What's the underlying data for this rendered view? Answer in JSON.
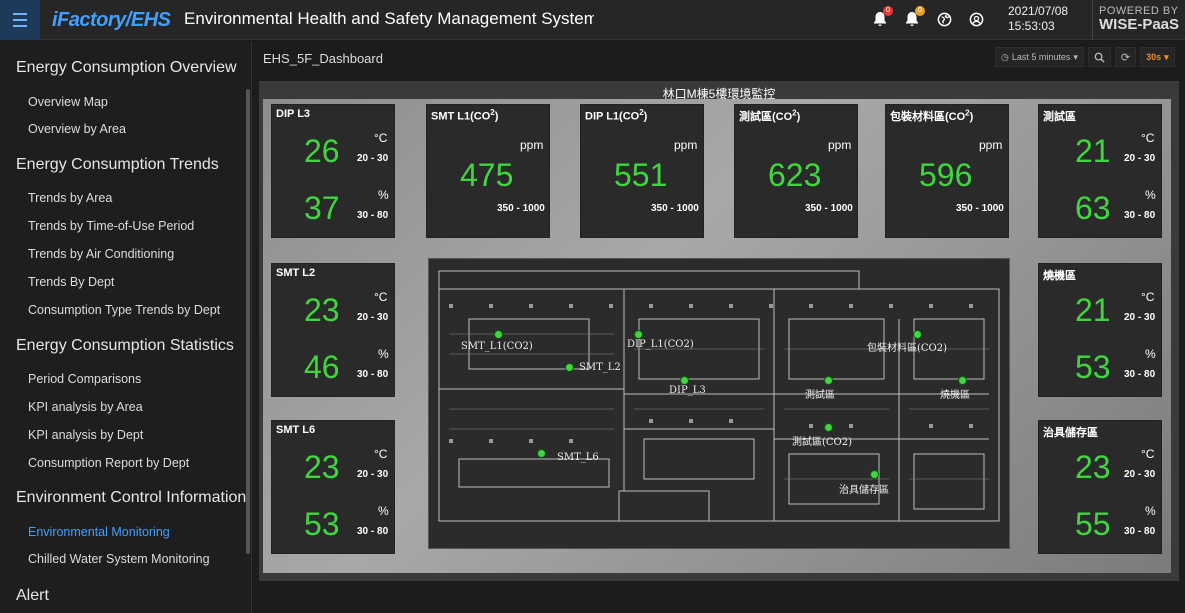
{
  "topbar": {
    "logo": "iFactory/EHS",
    "title": "Environmental Health and Safety Management System",
    "icons": [
      "bell-icon",
      "bell-icon",
      "globe-icon",
      "user-icon"
    ],
    "badge1": "0",
    "badge2": "0",
    "date": "2021/07/08",
    "time": "15:53:03",
    "powered_line1": "POWERED BY",
    "powered_line2": "WISE-PaaS",
    "accent": "#3fa0ff"
  },
  "sidebar": {
    "sections": [
      {
        "title": "Energy Consumption Overview",
        "items": [
          "Overview Map",
          "Overview by Area"
        ]
      },
      {
        "title": "Energy Consumption Trends",
        "items": [
          "Trends by Area",
          "Trends by Time-of-Use Period",
          "Trends by Air Conditioning",
          "Trends By Dept",
          "Consumption Type Trends by Dept"
        ]
      },
      {
        "title": "Energy Consumption Statistics",
        "items": [
          "Period Comparisons",
          "KPI analysis by Area",
          "KPI analysis by Dept",
          "Consumption Report by Dept"
        ]
      },
      {
        "title": "Environment Control Information",
        "items": [
          "Environmental Monitoring",
          "Chilled Water System Monitoring"
        ]
      },
      {
        "title": "Alert",
        "items": []
      }
    ],
    "active_item": "Environmental Monitoring"
  },
  "dashboard": {
    "title": "EHS_5F_Dashboard",
    "time_range": "Last 5 minutes",
    "refresh": "30s",
    "panel_title": "林口M棟5樓環境監控"
  },
  "tiles": {
    "dip_l3": {
      "name": "DIP L3",
      "temp": "26",
      "temp_unit": "°C",
      "temp_range": "20 - 30",
      "hum": "37",
      "hum_unit": "%",
      "hum_range": "30 - 80"
    },
    "smt_l2": {
      "name": "SMT L2",
      "temp": "23",
      "temp_unit": "°C",
      "temp_range": "20 - 30",
      "hum": "46",
      "hum_unit": "%",
      "hum_range": "30 - 80"
    },
    "smt_l6": {
      "name": "SMT L6",
      "temp": "23",
      "temp_unit": "°C",
      "temp_range": "20 - 30",
      "hum": "53",
      "hum_unit": "%",
      "hum_range": "30 - 80"
    },
    "test_area": {
      "name": "測試區",
      "temp": "21",
      "temp_unit": "°C",
      "temp_range": "20 - 30",
      "hum": "63",
      "hum_unit": "%",
      "hum_range": "30 - 80"
    },
    "burn_area": {
      "name": "燒機區",
      "temp": "21",
      "temp_unit": "°C",
      "temp_range": "20 - 30",
      "hum": "53",
      "hum_unit": "%",
      "hum_range": "30 - 80"
    },
    "fixture_store": {
      "name": "治具儲存區",
      "temp": "23",
      "temp_unit": "°C",
      "temp_range": "20 - 30",
      "hum": "55",
      "hum_unit": "%",
      "hum_range": "30 - 80"
    },
    "co2_smt_l1": {
      "name": "SMT L1(CO",
      "sub": "2",
      "tail": ")",
      "value": "475",
      "unit": "ppm",
      "range": "350 - 1000"
    },
    "co2_dip_l1": {
      "name": "DIP L1(CO",
      "sub": "2",
      "tail": ")",
      "value": "551",
      "unit": "ppm",
      "range": "350 - 1000"
    },
    "co2_test": {
      "name": "測試區(CO",
      "sub": "2",
      "tail": ")",
      "value": "623",
      "unit": "ppm",
      "range": "350 - 1000"
    },
    "co2_pack": {
      "name": "包裝材料區(CO",
      "sub": "2",
      "tail": ")",
      "value": "596",
      "unit": "ppm",
      "range": "350 - 1000"
    }
  },
  "map": {
    "labels": {
      "smt_l1": "SMT_L1(CO2)",
      "smt_l2": "SMT_L2",
      "dip_l1": "DIP_L1(CO2)",
      "dip_l3": "DIP_L3",
      "pack": "包裝材料區(CO2)",
      "test1": "測試區",
      "burn": "燒機區",
      "test_co2": "測試區(CO2)",
      "smt_l6": "SMT_L6",
      "fixture": "治具儲存區"
    },
    "sensor_color": "#3fd63f"
  }
}
